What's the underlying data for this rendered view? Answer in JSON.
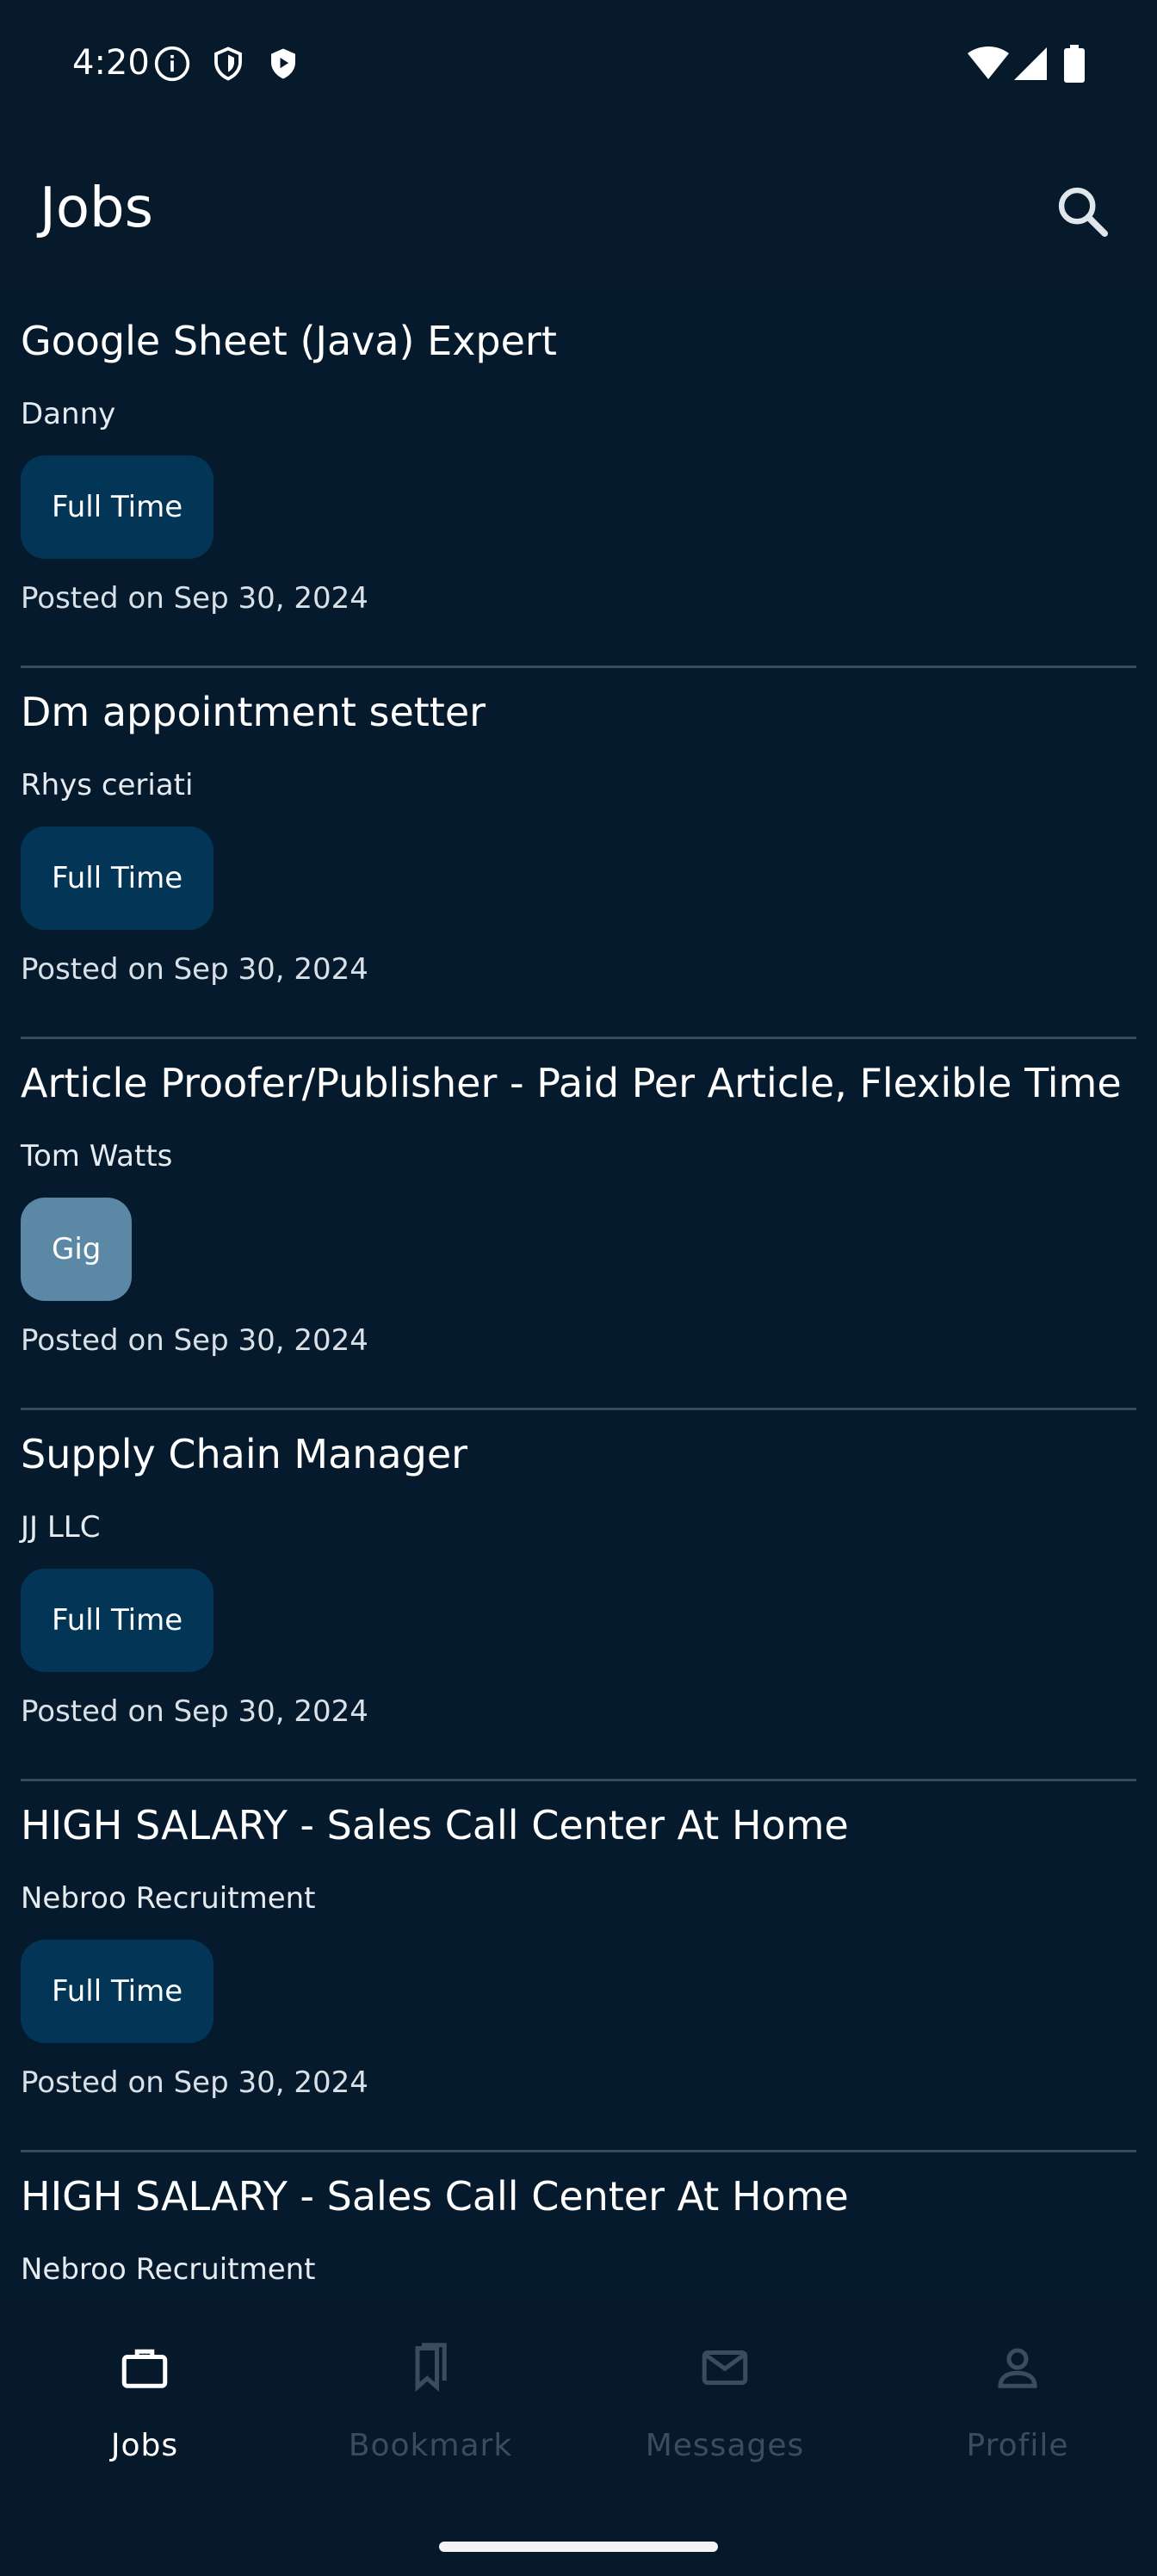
{
  "status_bar": {
    "time": "4:20"
  },
  "app_bar": {
    "title": "Jobs"
  },
  "jobs": [
    {
      "title": "Google Sheet (Java) Expert",
      "company": "Danny",
      "type": "Full Time",
      "posted": "Posted on Sep 30, 2024"
    },
    {
      "title": "Dm appointment setter",
      "company": "Rhys ceriati",
      "type": "Full Time",
      "posted": "Posted on Sep 30, 2024"
    },
    {
      "title": "Article Proofer/Publisher - Paid Per Article, Flexible Time",
      "company": "Tom Watts",
      "type": "Gig",
      "posted": "Posted on Sep 30, 2024"
    },
    {
      "title": "Supply Chain Manager",
      "company": "JJ LLC",
      "type": "Full Time",
      "posted": "Posted on Sep 30, 2024"
    },
    {
      "title": "HIGH SALARY - Sales Call Center At Home",
      "company": "Nebroo Recruitment",
      "type": "Full Time",
      "posted": "Posted on Sep 30, 2024"
    },
    {
      "title": "HIGH SALARY - Sales Call Center At Home",
      "company": "Nebroo Recruitment",
      "type": "",
      "posted": ""
    }
  ],
  "bottom_nav": {
    "items": [
      {
        "label": "Jobs",
        "icon": "briefcase-icon",
        "active": true
      },
      {
        "label": "Bookmark",
        "icon": "bookmark-icon",
        "active": false
      },
      {
        "label": "Messages",
        "icon": "mail-icon",
        "active": false
      },
      {
        "label": "Profile",
        "icon": "person-icon",
        "active": false
      }
    ]
  },
  "colors": {
    "background": "#051a2c",
    "chip_full_time": "#033556",
    "chip_gig": "#5b88a4",
    "nav_inactive": "#3a4d5e"
  }
}
